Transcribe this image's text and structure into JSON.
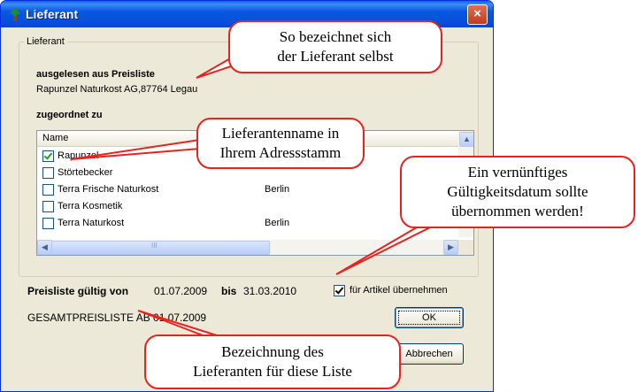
{
  "window": {
    "title": "Lieferant",
    "close_glyph": "×"
  },
  "group": {
    "legend": "Lieferant",
    "source_heading": "ausgelesen aus Preisliste",
    "source_value": "Rapunzel Naturkost AG,87764 Legau",
    "assigned_heading": "zugeordnet zu"
  },
  "list": {
    "column_name": "Name",
    "rows": [
      {
        "name": "Rapunzel",
        "city": "",
        "checked": true
      },
      {
        "name": "Störtebecker",
        "city": "",
        "checked": false
      },
      {
        "name": "Terra Frische Naturkost",
        "city": "Berlin",
        "checked": false
      },
      {
        "name": "Terra Kosmetik",
        "city": "",
        "checked": false
      },
      {
        "name": "Terra Naturkost",
        "city": "Berlin",
        "checked": false
      }
    ],
    "scroll_up_glyph": "▲",
    "scroll_left_glyph": "◀",
    "scroll_right_glyph": "▶",
    "thumb_grip": "III"
  },
  "validity": {
    "label": "Preisliste gültig von",
    "from": "01.07.2009",
    "bis_label": "bis",
    "to": "31.03.2010",
    "apply_checkbox_label": "für Artikel übernehmen",
    "apply_checked": true
  },
  "pricelist_name": "GESAMTPREISLISTE AB 01.07.2009",
  "buttons": {
    "ok": "OK",
    "cancel": "Abbrechen"
  },
  "callouts": {
    "self_name_line1": "So bezeichnet sich",
    "self_name_line2": "der Lieferant selbst",
    "address_line1": "Lieferantenname in",
    "address_line2": "Ihrem Adressstamm",
    "date_line1": "Ein vernünftiges",
    "date_line2": "Gültigkeitsdatum sollte",
    "date_line3": "übernommen werden!",
    "list_line1": "Bezeichnung des",
    "list_line2": "Lieferanten für diese Liste"
  },
  "colors": {
    "titlebar": "#0a58e0",
    "callout_border": "#e8231d",
    "dialog_bg": "#ece9d8"
  },
  "icons": {
    "app": "tree-icon",
    "close": "close-icon"
  }
}
